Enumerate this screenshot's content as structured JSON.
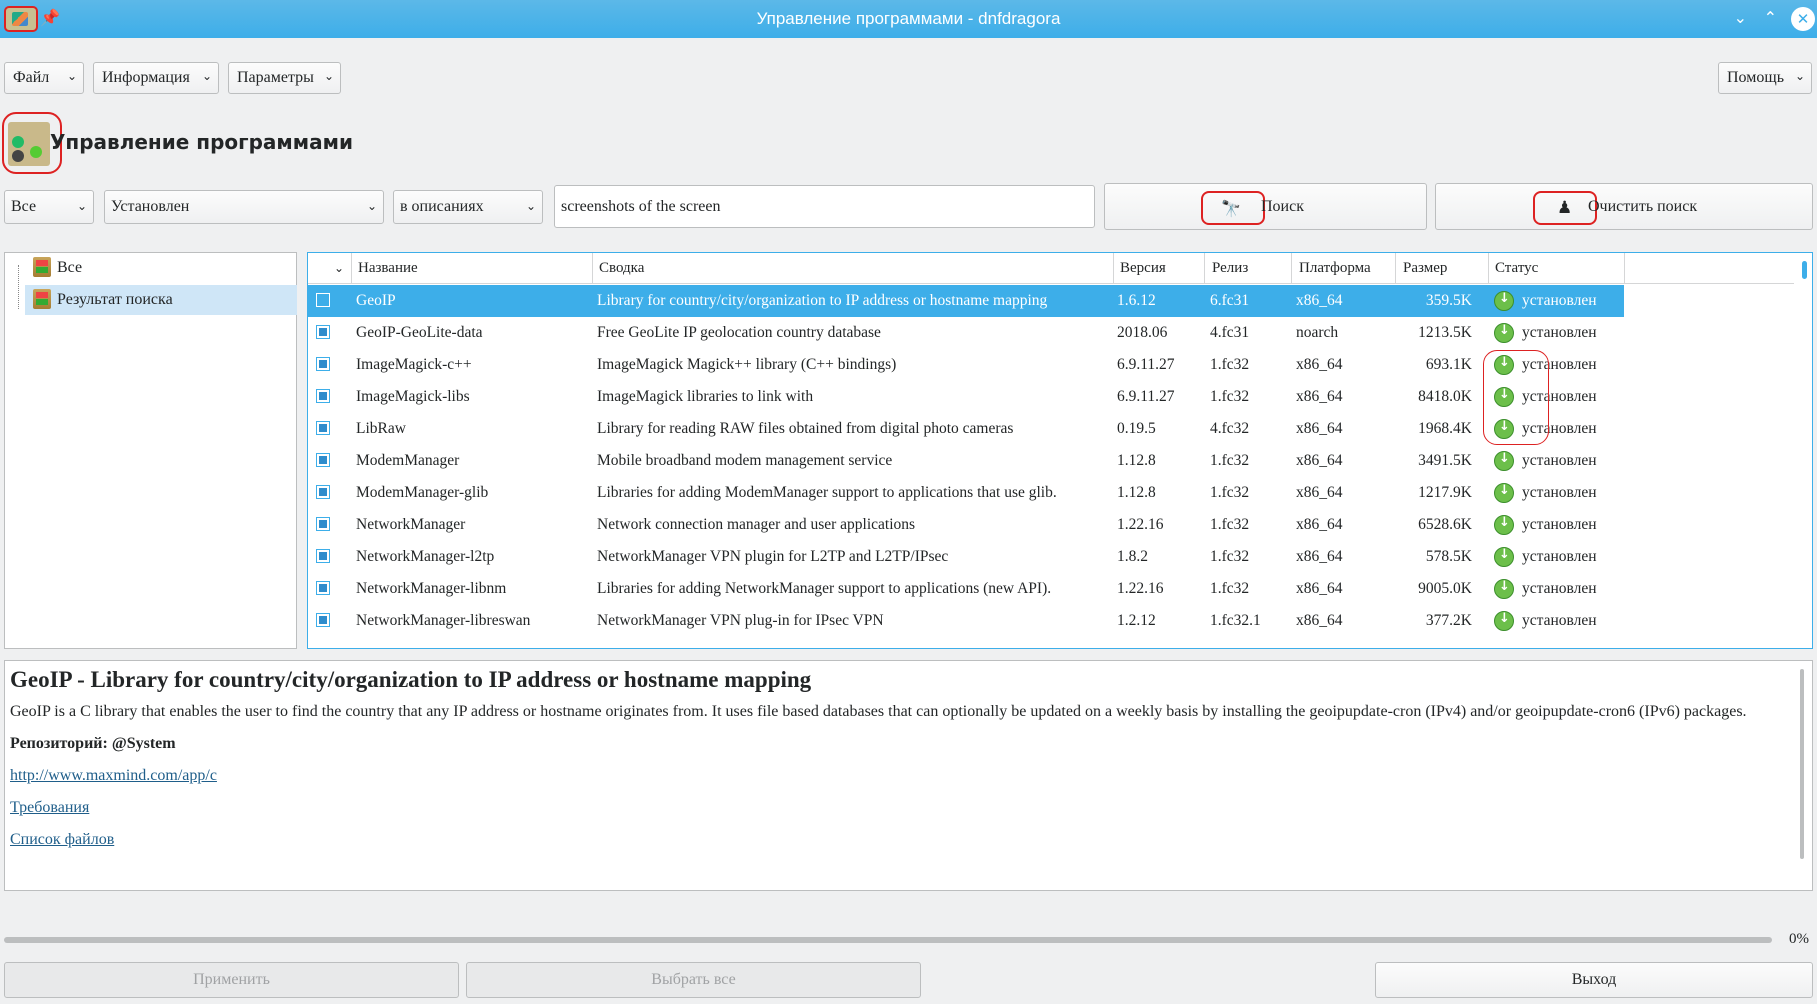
{
  "window": {
    "title": "Управление программами - dnfdragora"
  },
  "menus": {
    "file": "Файл",
    "info": "Информация",
    "params": "Параметры",
    "help": "Помощь"
  },
  "header": {
    "title": "Управление программами"
  },
  "filters": {
    "scope": "Все",
    "state": "Установлен",
    "field": "в описаниях",
    "query": "screenshots of the screen"
  },
  "actions": {
    "search": "Поиск",
    "clear_search": "Очистить поиск"
  },
  "tree": {
    "items": [
      {
        "label": "Все"
      },
      {
        "label": "Результат поиска",
        "selected": true
      }
    ]
  },
  "table": {
    "columns": {
      "name": "Название",
      "summary": "Сводка",
      "version": "Версия",
      "release": "Релиз",
      "platform": "Платформа",
      "size": "Размер",
      "status": "Статус"
    },
    "rows": [
      {
        "name": "GeoIP",
        "summary": "Library for country/city/organization to IP address or hostname mapping",
        "version": "1.6.12",
        "release": "6.fc31",
        "platform": "x86_64",
        "size": "359.5K",
        "status": "установлен",
        "selected": true
      },
      {
        "name": "GeoIP-GeoLite-data",
        "summary": "Free GeoLite IP geolocation country database",
        "version": "2018.06",
        "release": "4.fc31",
        "platform": "noarch",
        "size": "1213.5K",
        "status": "установлен"
      },
      {
        "name": "ImageMagick-c++",
        "summary": "ImageMagick Magick++ library (C++ bindings)",
        "version": "6.9.11.27",
        "release": "1.fc32",
        "platform": "x86_64",
        "size": "693.1K",
        "status": "установлен"
      },
      {
        "name": "ImageMagick-libs",
        "summary": "ImageMagick libraries to link with",
        "version": "6.9.11.27",
        "release": "1.fc32",
        "platform": "x86_64",
        "size": "8418.0K",
        "status": "установлен"
      },
      {
        "name": "LibRaw",
        "summary": "Library for reading RAW files obtained from digital photo cameras",
        "version": "0.19.5",
        "release": "4.fc32",
        "platform": "x86_64",
        "size": "1968.4K",
        "status": "установлен"
      },
      {
        "name": "ModemManager",
        "summary": "Mobile broadband modem management service",
        "version": "1.12.8",
        "release": "1.fc32",
        "platform": "x86_64",
        "size": "3491.5K",
        "status": "установлен"
      },
      {
        "name": "ModemManager-glib",
        "summary": "Libraries for adding ModemManager support to applications that use glib.",
        "version": "1.12.8",
        "release": "1.fc32",
        "platform": "x86_64",
        "size": "1217.9K",
        "status": "установлен"
      },
      {
        "name": "NetworkManager",
        "summary": "Network connection manager and user applications",
        "version": "1.22.16",
        "release": "1.fc32",
        "platform": "x86_64",
        "size": "6528.6K",
        "status": "установлен"
      },
      {
        "name": "NetworkManager-l2tp",
        "summary": "NetworkManager VPN plugin for L2TP and L2TP/IPsec",
        "version": "1.8.2",
        "release": "1.fc32",
        "platform": "x86_64",
        "size": "578.5K",
        "status": "установлен"
      },
      {
        "name": "NetworkManager-libnm",
        "summary": "Libraries for adding NetworkManager support to applications (new API).",
        "version": "1.22.16",
        "release": "1.fc32",
        "platform": "x86_64",
        "size": "9005.0K",
        "status": "установлен"
      },
      {
        "name": "NetworkManager-libreswan",
        "summary": "NetworkManager VPN plug-in for IPsec VPN",
        "version": "1.2.12",
        "release": "1.fc32.1",
        "platform": "x86_64",
        "size": "377.2K",
        "status": "установлен"
      }
    ]
  },
  "details": {
    "heading": "GeoIP - Library for country/city/organization to IP address or hostname mapping",
    "description": "GeoIP is a C library that enables the user to find the country that any IP address or hostname originates from. It uses file based databases that can optionally be updated on a weekly basis by installing the geoipupdate-cron (IPv4) and/or geoipupdate-cron6 (IPv6) packages.",
    "repository": "Репозиторий: @System",
    "url": "http://www.maxmind.com/app/c",
    "requirements": "Требования",
    "file_list": "Список файлов"
  },
  "progress": {
    "value": 0,
    "label": "0%"
  },
  "buttons": {
    "apply": "Применить",
    "select_all": "Выбрать все",
    "exit": "Выход"
  }
}
